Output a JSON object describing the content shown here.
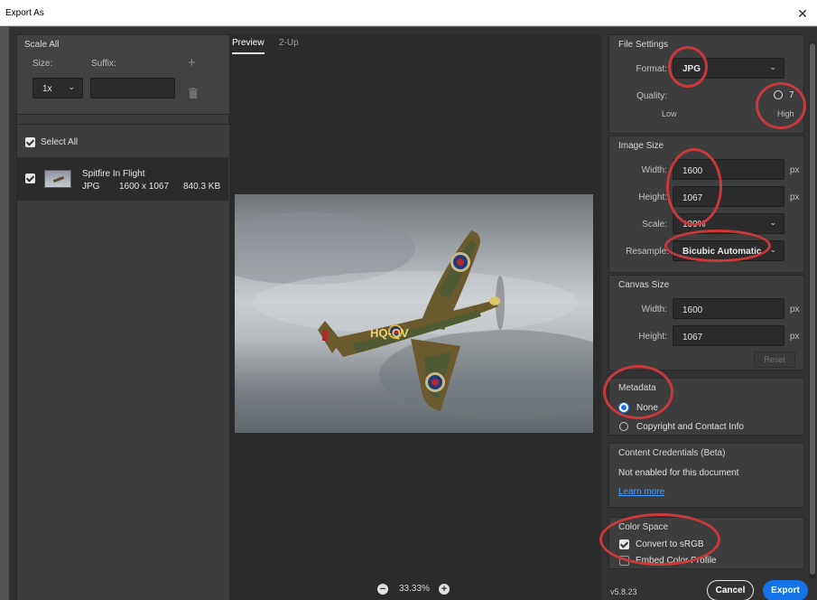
{
  "window": {
    "title": "Export As",
    "close_glyph": "✕"
  },
  "scale_all": {
    "title": "Scale All",
    "size_label": "Size:",
    "suffix_label": "Suffix:",
    "size_value": "1x",
    "suffix_value": "",
    "add_glyph": "+"
  },
  "assets": {
    "select_all_label": "Select All",
    "items": [
      {
        "name": "Spitfire In Flight",
        "format": "JPG",
        "dimensions": "1600 x 1067",
        "size": "840.3 KB"
      }
    ]
  },
  "preview": {
    "tabs": [
      {
        "label": "Preview"
      },
      {
        "label": "2-Up"
      }
    ],
    "zoom_value": "33.33%",
    "zoom_out_glyph": "−",
    "zoom_in_glyph": "+",
    "aircraft_code": "HQ-QV"
  },
  "file_settings": {
    "title": "File Settings",
    "format_label": "Format:",
    "format_value": "JPG",
    "quality_label": "Quality:",
    "quality_value": "7",
    "quality_low": "Low",
    "quality_high": "High"
  },
  "image_size": {
    "title": "Image Size",
    "width_label": "Width:",
    "width_value": "1600",
    "height_label": "Height:",
    "height_value": "1067",
    "scale_label": "Scale:",
    "scale_value": "100%",
    "resample_label": "Resample:",
    "resample_value": "Bicubic Automatic",
    "unit": "px"
  },
  "canvas_size": {
    "title": "Canvas Size",
    "width_label": "Width:",
    "width_value": "1600",
    "height_label": "Height:",
    "height_value": "1067",
    "unit": "px",
    "reset_label": "Reset"
  },
  "metadata": {
    "title": "Metadata",
    "options": [
      {
        "label": "None",
        "selected": true
      },
      {
        "label": "Copyright and Contact Info",
        "selected": false
      }
    ]
  },
  "content_credentials": {
    "title": "Content Credentials (Beta)",
    "status": "Not enabled for this document",
    "learn_more": "Learn more"
  },
  "color_space": {
    "title": "Color Space",
    "convert_label": "Convert to sRGB",
    "convert_checked": true,
    "embed_label": "Embed Color Profile",
    "embed_checked": false
  },
  "footer": {
    "version": "v5.8.23",
    "cancel_label": "Cancel",
    "export_label": "Export"
  },
  "colors": {
    "accent": "#1473e6",
    "annotation": "#c9383b",
    "panel": "#3d3d3d"
  }
}
